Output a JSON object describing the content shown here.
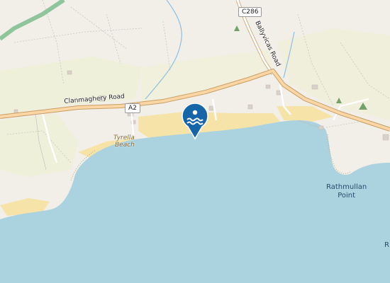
{
  "map": {
    "roads": {
      "clanmaghery": "Clanmaghery Road",
      "a2_ref": "A2",
      "c286_ref": "C286",
      "ballykilbeg": "Ballyvicas Road"
    },
    "places": {
      "tyrella_beach_line1": "Tyrella",
      "tyrella_beach_line2": "Beach",
      "rathmullan_line1": "Rathmullan",
      "rathmullan_line2": "Point",
      "edge_label": "R"
    },
    "marker": {
      "icon": "swimming-icon",
      "color": "#1565a8"
    },
    "colors": {
      "land": "#f2efe9",
      "water": "#aad3df",
      "sand": "#f5e3a8",
      "main_road": "#fcd6a4",
      "road_casing": "#c99d63"
    }
  }
}
